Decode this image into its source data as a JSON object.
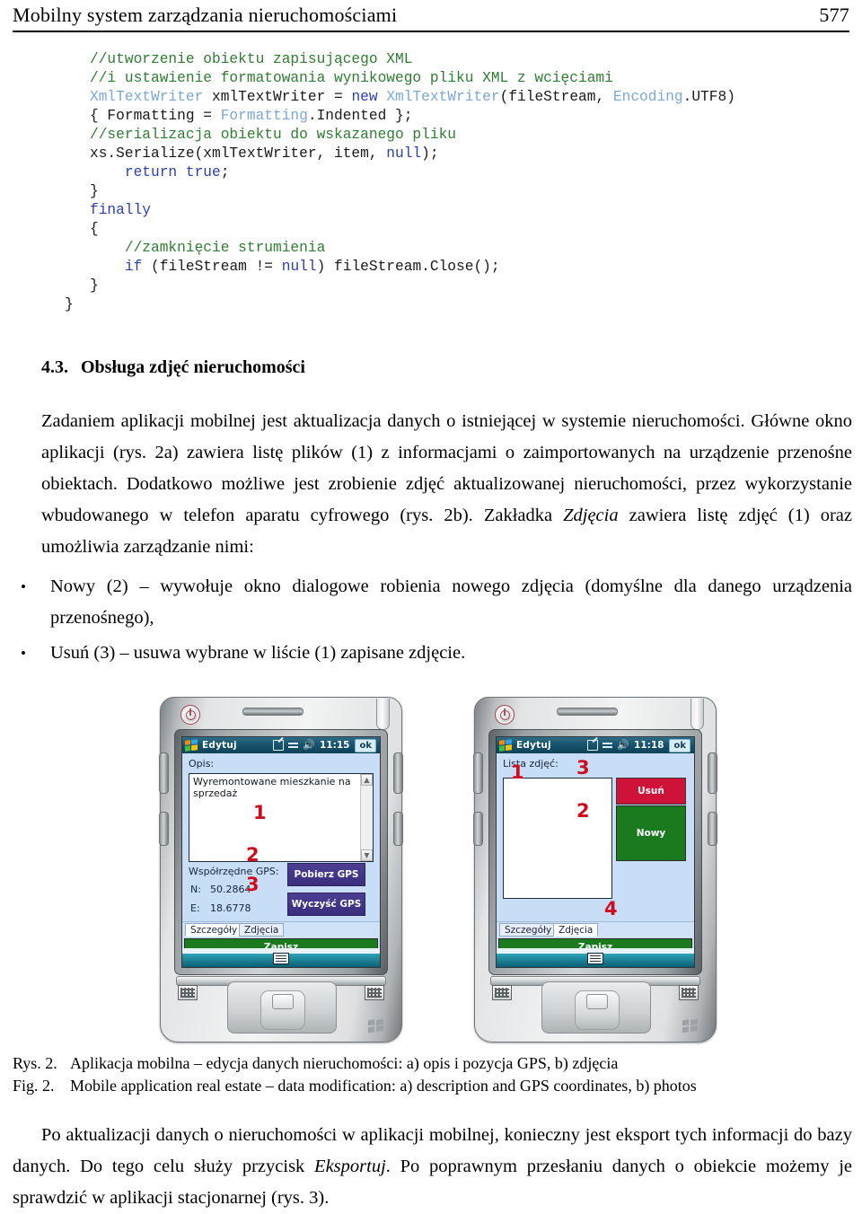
{
  "header": {
    "title": "Mobilny system zarządzania nieruchomościami",
    "page_number": "577"
  },
  "code_listing": {
    "lines": [
      {
        "indent": 0,
        "tokens": [
          {
            "t": "//utworzenie obiektu zapisującego XML",
            "c": "cm"
          }
        ]
      },
      {
        "indent": 0,
        "tokens": [
          {
            "t": "//i ustawienie formatowania wynikowego pliku XML z wcięciami",
            "c": "cm"
          }
        ]
      },
      {
        "indent": 0,
        "tokens": [
          {
            "t": "XmlTextWriter",
            "c": "ty"
          },
          {
            "t": " xmlTextWriter = ",
            "c": "pl"
          },
          {
            "t": "new",
            "c": "kw"
          },
          {
            "t": " ",
            "c": "pl"
          },
          {
            "t": "XmlTextWriter",
            "c": "ty"
          },
          {
            "t": "(fileStream, ",
            "c": "pl"
          },
          {
            "t": "Encoding",
            "c": "ty"
          },
          {
            "t": ".UTF8)",
            "c": "pl"
          }
        ]
      },
      {
        "indent": 0,
        "tokens": [
          {
            "t": "{ Formatting = ",
            "c": "pl"
          },
          {
            "t": "Formatting",
            "c": "ty"
          },
          {
            "t": ".Indented };",
            "c": "pl"
          }
        ]
      },
      {
        "indent": 0,
        "tokens": [
          {
            "t": "//serializacja obiektu do wskazanego pliku",
            "c": "cm"
          }
        ]
      },
      {
        "indent": 0,
        "tokens": [
          {
            "t": "xs.Serialize(xmlTextWriter, item, ",
            "c": "pl"
          },
          {
            "t": "null",
            "c": "kw"
          },
          {
            "t": ");",
            "c": "pl"
          }
        ]
      },
      {
        "indent": 1,
        "tokens": [
          {
            "t": "return",
            "c": "kw"
          },
          {
            "t": " ",
            "c": "pl"
          },
          {
            "t": "true",
            "c": "kw"
          },
          {
            "t": ";",
            "c": "pl"
          }
        ]
      },
      {
        "indent": 0,
        "tokens": [
          {
            "t": "}",
            "c": "pl"
          }
        ]
      },
      {
        "indent": 0,
        "tokens": [
          {
            "t": "finally",
            "c": "kw"
          }
        ]
      },
      {
        "indent": 0,
        "tokens": [
          {
            "t": "{",
            "c": "pl"
          }
        ]
      },
      {
        "indent": 1,
        "tokens": [
          {
            "t": "//zamknięcie strumienia",
            "c": "cm"
          }
        ]
      },
      {
        "indent": 1,
        "tokens": [
          {
            "t": "if",
            "c": "kw"
          },
          {
            "t": " (fileStream != ",
            "c": "pl"
          },
          {
            "t": "null",
            "c": "kw"
          },
          {
            "t": ") fileStream.Close();",
            "c": "pl"
          }
        ]
      },
      {
        "indent": 0,
        "tokens": [
          {
            "t": "}",
            "c": "pl"
          }
        ]
      },
      {
        "indent": -1,
        "tokens": [
          {
            "t": "}",
            "c": "pl"
          }
        ]
      }
    ]
  },
  "section": {
    "number": "4.3.",
    "title": "Obsługa zdjęć nieruchomości"
  },
  "paragraph_1": {
    "part_a": "Zadaniem aplikacji mobilnej jest aktualizacja danych o istniejącej w systemie nieruchomości. Główne okno aplikacji (rys. 2a) zawiera listę plików (1) z informacjami o zaimportowanych na urządzenie przenośne obiektach. Dodatkowo możliwe jest zrobienie zdjęć aktualizowanej nieruchomości, przez wykorzystanie wbudowanego w telefon aparatu cyfrowego (rys. 2b). Zakładka ",
    "emphasis": "Zdjęcia",
    "part_b": " zawiera listę zdjęć (1) oraz umożliwia zarządzanie nimi:"
  },
  "bullets": [
    {
      "marker": "•",
      "text": "Nowy (2) – wywołuje okno dialogowe robienia nowego zdjęcia (domyślne dla danego urządzenia przenośnego),"
    },
    {
      "marker": "•",
      "text": "Usuń (3) – usuwa wybrane w liście (1) zapisane zdjęcie."
    }
  ],
  "figure": {
    "device_a": {
      "titlebar": {
        "app_title": "Edytuj",
        "time": "11:15",
        "ok_label": "ok",
        "icons": [
          "windows-flag-icon",
          "pencil-icon",
          "network-icon",
          "speaker-icon"
        ]
      },
      "description_label": "Opis:",
      "description_value": "Wyremontowane mieszkanie na sprzedaż",
      "gps_label": "Współrzędne GPS:",
      "gps_north_label": "N:",
      "gps_north_value": "50.2864",
      "gps_east_label": "E:",
      "gps_east_value": "18.6778",
      "button_get_gps": "Pobierz GPS",
      "button_clear_gps": "Wyczyść GPS",
      "tabs": [
        {
          "label": "Szczegóły",
          "active": true
        },
        {
          "label": "Zdjęcia",
          "active": false
        }
      ],
      "save_button": "Zapisz",
      "annotations": [
        {
          "number": "1",
          "target": "description-textbox"
        },
        {
          "number": "2",
          "target": "get-gps-button"
        },
        {
          "number": "3",
          "target": "clear-gps-button"
        }
      ]
    },
    "device_b": {
      "titlebar": {
        "app_title": "Edytuj",
        "time": "11:18",
        "ok_label": "ok",
        "icons": [
          "windows-flag-icon",
          "pencil-icon",
          "network-icon",
          "speaker-icon"
        ]
      },
      "list_label": "Lista zdjęć:",
      "button_delete": "Usuń",
      "button_new": "Nowy",
      "tabs": [
        {
          "label": "Szczegóły",
          "active": false
        },
        {
          "label": "Zdjęcia",
          "active": true
        }
      ],
      "save_button": "Zapisz",
      "annotations": [
        {
          "number": "1",
          "target": "photo-list"
        },
        {
          "number": "3",
          "target": "delete-button"
        },
        {
          "number": "2",
          "target": "new-button"
        },
        {
          "number": "4",
          "target": "save-button"
        }
      ]
    }
  },
  "caption": {
    "pl_label": "Rys. 2.",
    "pl_text": "Aplikacja mobilna – edycja danych nieruchomości: a) opis i pozycja GPS, b) zdjęcia",
    "en_label": "Fig. 2.",
    "en_text": "Mobile application real estate – data modification: a) description and GPS coordinates, b) photos"
  },
  "paragraph_last": {
    "part_a": "Po aktualizacji danych o nieruchomości w aplikacji mobilnej, konieczny jest eksport tych informacji do bazy danych. Do tego celu służy przycisk ",
    "emphasis": "Eksportuj",
    "part_b": ". Po poprawnym przesłaniu danych o obiekcie możemy je sprawdzić w aplikacji stacjonarnej (rys. 3)."
  },
  "colors": {
    "comment_green": "#2f7d32",
    "type_blue": "#7ba7d7",
    "keyword_blue": "#2a3fb0",
    "annotation_red": "#cf0a1e",
    "screen_background": "#c8ddf6",
    "button_purple": "#3a2e7d",
    "button_green": "#1a7a1e",
    "button_red": "#cf1338",
    "titlebar_teal": "#17546d"
  }
}
